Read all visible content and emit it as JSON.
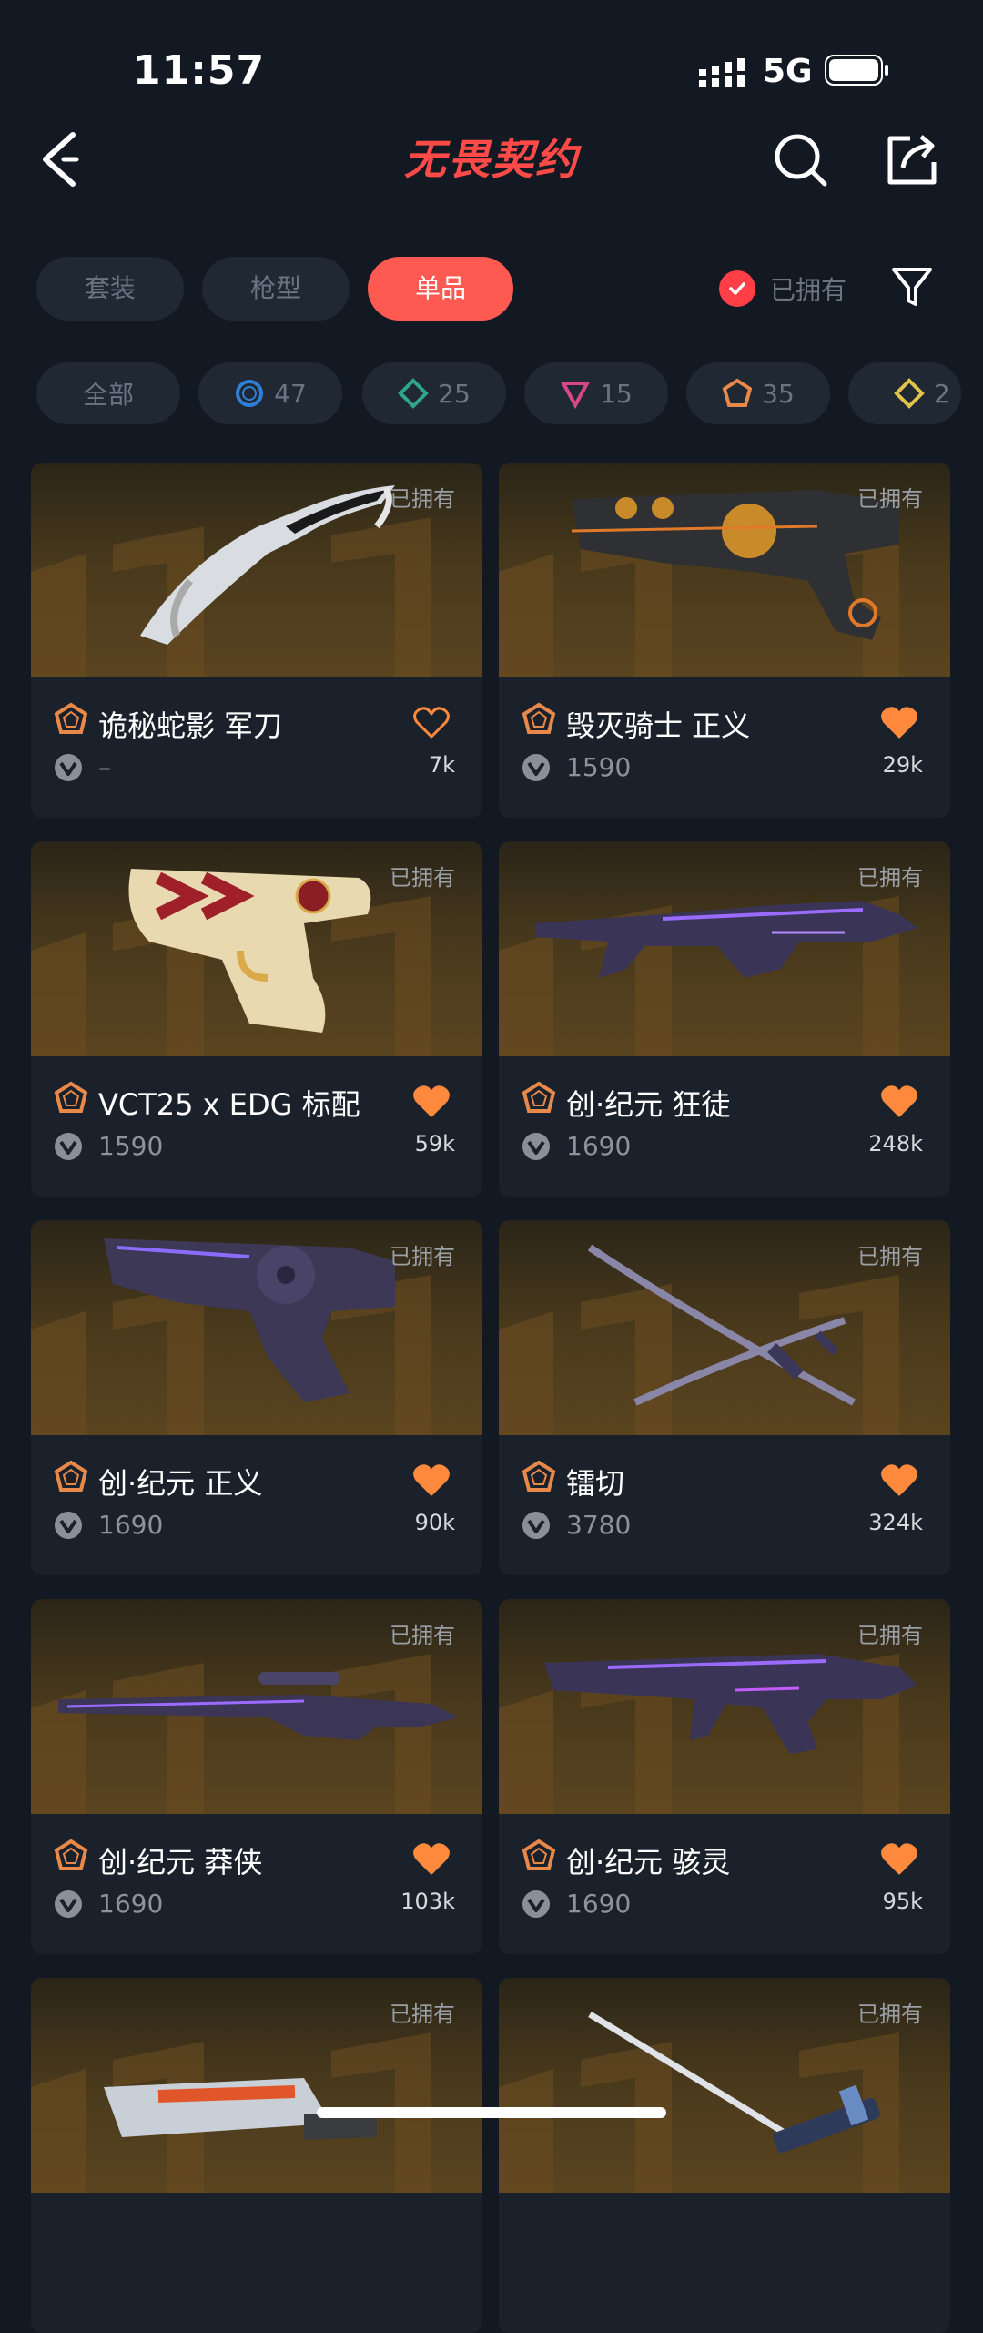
{
  "status": {
    "time": "11:57",
    "network": "5G"
  },
  "header": {
    "title": "无畏契约"
  },
  "tabs": [
    {
      "label": "套装",
      "active": false
    },
    {
      "label": "枪型",
      "active": false
    },
    {
      "label": "单品",
      "active": true
    }
  ],
  "owned_filter": {
    "label": "已拥有",
    "checked": true
  },
  "tier_chips": [
    {
      "label": "全部",
      "icon": "none"
    },
    {
      "label": "47",
      "icon": "blue-tier-icon",
      "color": "#2f7fd6"
    },
    {
      "label": "25",
      "icon": "teal-tier-icon",
      "color": "#2fa58c"
    },
    {
      "label": "15",
      "icon": "pink-tier-icon",
      "color": "#d9468a"
    },
    {
      "label": "35",
      "icon": "orange-tier-icon",
      "color": "#e8894a"
    },
    {
      "label": "2",
      "icon": "gold-tier-icon",
      "color": "#e2c34a"
    }
  ],
  "items": [
    {
      "name": "诡秘蛇影 军刀",
      "price": "–",
      "likes": "7k",
      "liked": false,
      "owned_label": "已拥有",
      "weapon": "knife"
    },
    {
      "name": "毁灭骑士 正义",
      "price": "1590",
      "likes": "29k",
      "liked": true,
      "owned_label": "已拥有",
      "weapon": "revolver-black"
    },
    {
      "name": "VCT25 x EDG 标配",
      "price": "1590",
      "likes": "59k",
      "liked": true,
      "owned_label": "已拥有",
      "weapon": "pistol-edg"
    },
    {
      "name": "创·纪元 狂徒",
      "price": "1690",
      "likes": "248k",
      "liked": true,
      "owned_label": "已拥有",
      "weapon": "rifle-purple"
    },
    {
      "name": "创·纪元 正义",
      "price": "1690",
      "likes": "90k",
      "liked": true,
      "owned_label": "已拥有",
      "weapon": "revolver-purple"
    },
    {
      "name": "镭切",
      "price": "3780",
      "likes": "324k",
      "liked": true,
      "owned_label": "已拥有",
      "weapon": "swords"
    },
    {
      "name": "创·纪元 莽侠",
      "price": "1690",
      "likes": "103k",
      "liked": true,
      "owned_label": "已拥有",
      "weapon": "sniper-purple"
    },
    {
      "name": "创·纪元 骇灵",
      "price": "1690",
      "likes": "95k",
      "liked": true,
      "owned_label": "已拥有",
      "weapon": "smg-purple"
    },
    {
      "name": "",
      "price": "",
      "likes": "",
      "liked": false,
      "owned_label": "已拥有",
      "weapon": "blade-red"
    },
    {
      "name": "",
      "price": "",
      "likes": "",
      "liked": false,
      "owned_label": "已拥有",
      "weapon": "katana"
    }
  ],
  "colors": {
    "accent": "#ff5a52",
    "heart": "#ff8a3d",
    "background": "#121923",
    "card": "#1a212b"
  }
}
